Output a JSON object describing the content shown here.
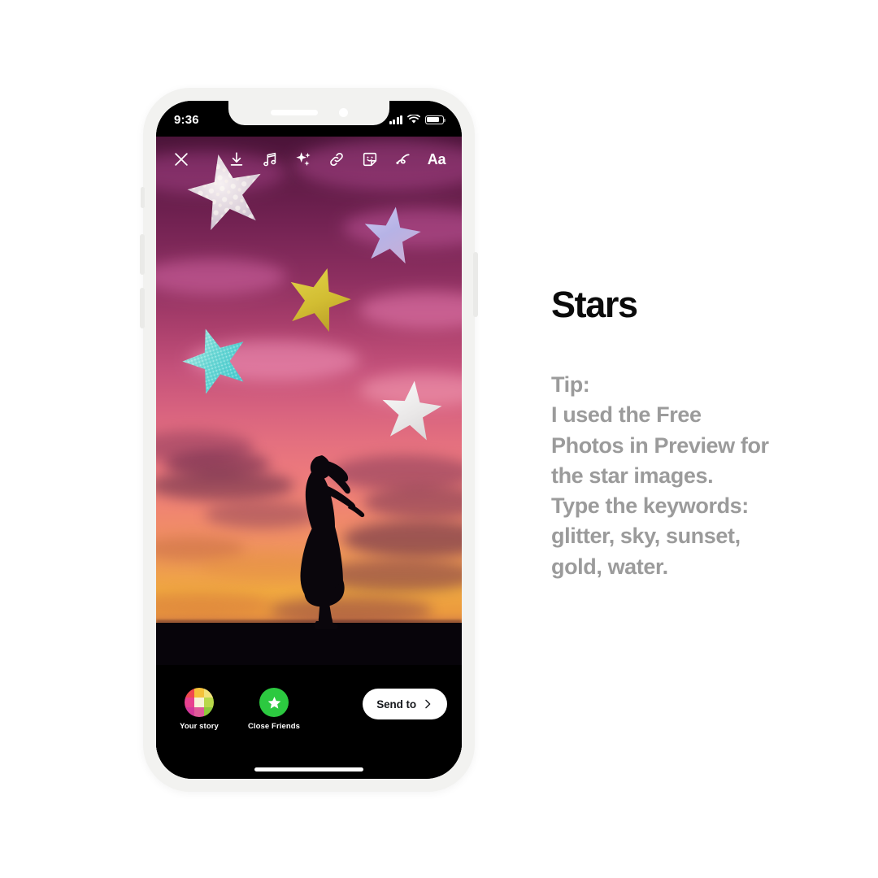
{
  "phone": {
    "status_bar": {
      "time": "9:36",
      "signal_icon": "cellular-bars-icon",
      "wifi_icon": "wifi-icon",
      "battery_icon": "battery-icon",
      "battery_level": 78
    },
    "toolbar": {
      "close": {
        "label": "Close",
        "icon": "close-x-icon"
      },
      "items": [
        {
          "label": "Save",
          "icon": "download-icon"
        },
        {
          "label": "Music",
          "icon": "music-note-icon"
        },
        {
          "label": "Effects",
          "icon": "sparkles-icon"
        },
        {
          "label": "Link",
          "icon": "link-icon"
        },
        {
          "label": "Stickers",
          "icon": "sticker-smiley-icon"
        },
        {
          "label": "Draw",
          "icon": "draw-squiggle-icon"
        },
        {
          "label": "Text",
          "icon": "text-aa-icon",
          "text": "Aa"
        }
      ]
    },
    "share": {
      "targets": [
        {
          "label": "Your story",
          "icon": "story-grid-avatar-icon"
        },
        {
          "label": "Close Friends",
          "icon": "close-friends-star-icon",
          "color": "#2cc940"
        }
      ],
      "send_button": {
        "label": "Send to",
        "icon": "chevron-right-icon"
      }
    },
    "home_indicator": "home-indicator-bar"
  },
  "story_content": {
    "scene": "woman silhouette dancing at sunset",
    "sky_colors": [
      "#4a1338",
      "#8d2f60",
      "#d8637f",
      "#f08472",
      "#f0a840"
    ],
    "stickers": [
      {
        "name": "glitter-star-white",
        "color": "#e8dfe6"
      },
      {
        "name": "star-lavender",
        "color": "#b9b6e4"
      },
      {
        "name": "star-gold",
        "color": "#d6c33a"
      },
      {
        "name": "glitter-star-teal",
        "color": "#58d2d2"
      },
      {
        "name": "star-white",
        "color": "#eceaea"
      }
    ]
  },
  "caption": {
    "title": "Stars",
    "body": "Tip:\nI used the Free\nPhotos in Preview for\nthe star images.\nType the keywords:\nglitter, sky, sunset,\ngold, water."
  }
}
